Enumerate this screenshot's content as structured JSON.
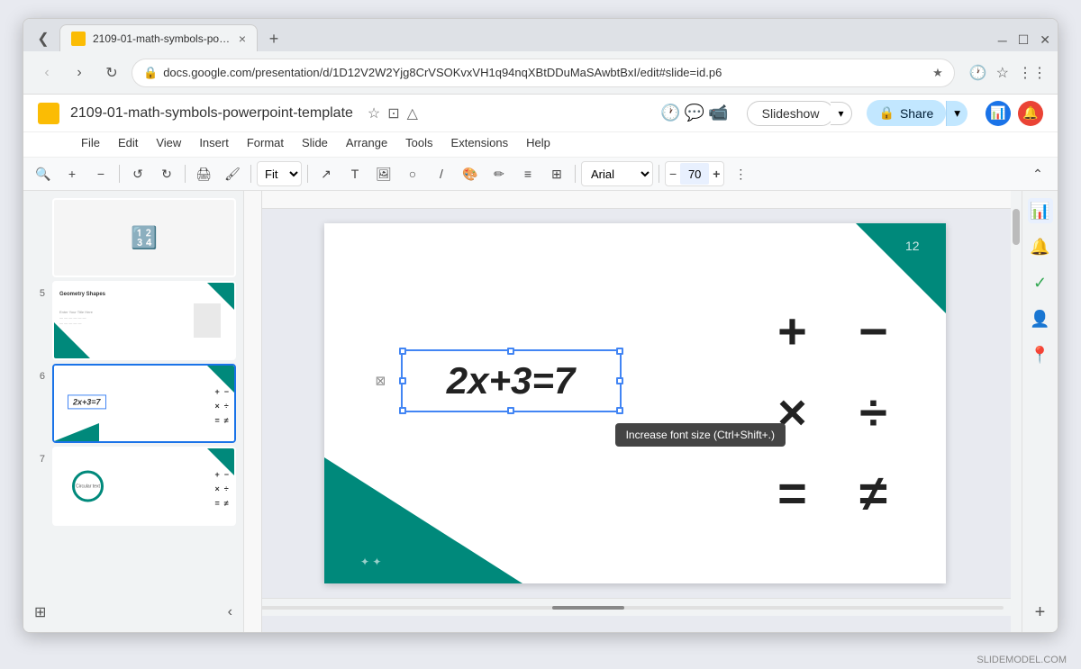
{
  "browser": {
    "tab_title": "2109-01-math-symbols-powe...",
    "tab_close": "×",
    "url": "docs.google.com/presentation/d/1D12V2W2Yjg8CrVSOKvxVH1q94nqXBtDDuMaSAwbtBxI/edit#slide=id.p6",
    "new_tab": "+"
  },
  "app": {
    "title": "2109-01-math-symbols-powerpoint-template",
    "logo_color": "#fbbc04"
  },
  "toolbar": {
    "slideshow_label": "Slideshow",
    "share_label": "Share",
    "zoom_value": "Fit",
    "font_family": "Arial",
    "font_size": "70",
    "tooltip": "Increase font size (Ctrl+Shift+.)"
  },
  "menu": {
    "items": [
      "File",
      "Edit",
      "View",
      "Insert",
      "Format",
      "Slide",
      "Arrange",
      "Tools",
      "Extensions",
      "Help"
    ]
  },
  "slides": [
    {
      "num": "5",
      "label": "Geometry Shapes"
    },
    {
      "num": "6",
      "label": ""
    },
    {
      "num": "7",
      "label": ""
    }
  ],
  "slide_content": {
    "equation": "2x+3=7",
    "equation_italic_part": "2x",
    "math_symbols": [
      "+",
      "−",
      "×",
      "÷",
      "=",
      "≠"
    ]
  },
  "footer": {
    "brand": "SLIDEMODEL.COM"
  }
}
